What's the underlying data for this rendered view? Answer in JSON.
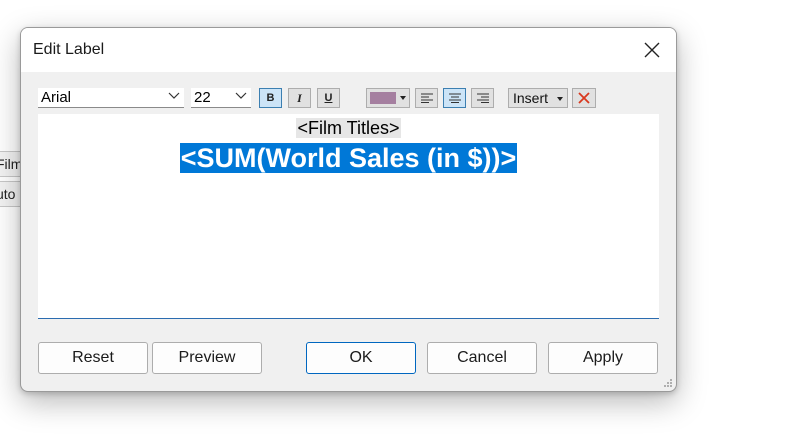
{
  "background": {
    "fragment_1": "Film",
    "fragment_2": "uto"
  },
  "dialog": {
    "title": "Edit Label"
  },
  "toolbar": {
    "font_family": "Arial",
    "font_size": "22",
    "bold": "B",
    "italic": "I",
    "underline": "U",
    "text_color": "#a57fa0",
    "insert_label": "Insert",
    "icons": {
      "align_left": "align-left-icon",
      "align_center": "align-center-icon",
      "align_right": "align-right-icon",
      "clear": "clear-x-icon"
    }
  },
  "editor": {
    "line1": "<Film Titles>",
    "line2": "<SUM(World Sales (in $))>"
  },
  "buttons": {
    "reset": "Reset",
    "preview": "Preview",
    "ok": "OK",
    "cancel": "Cancel",
    "apply": "Apply"
  },
  "colors": {
    "selection": "#0078d7",
    "accent_border": "#0067c0"
  }
}
